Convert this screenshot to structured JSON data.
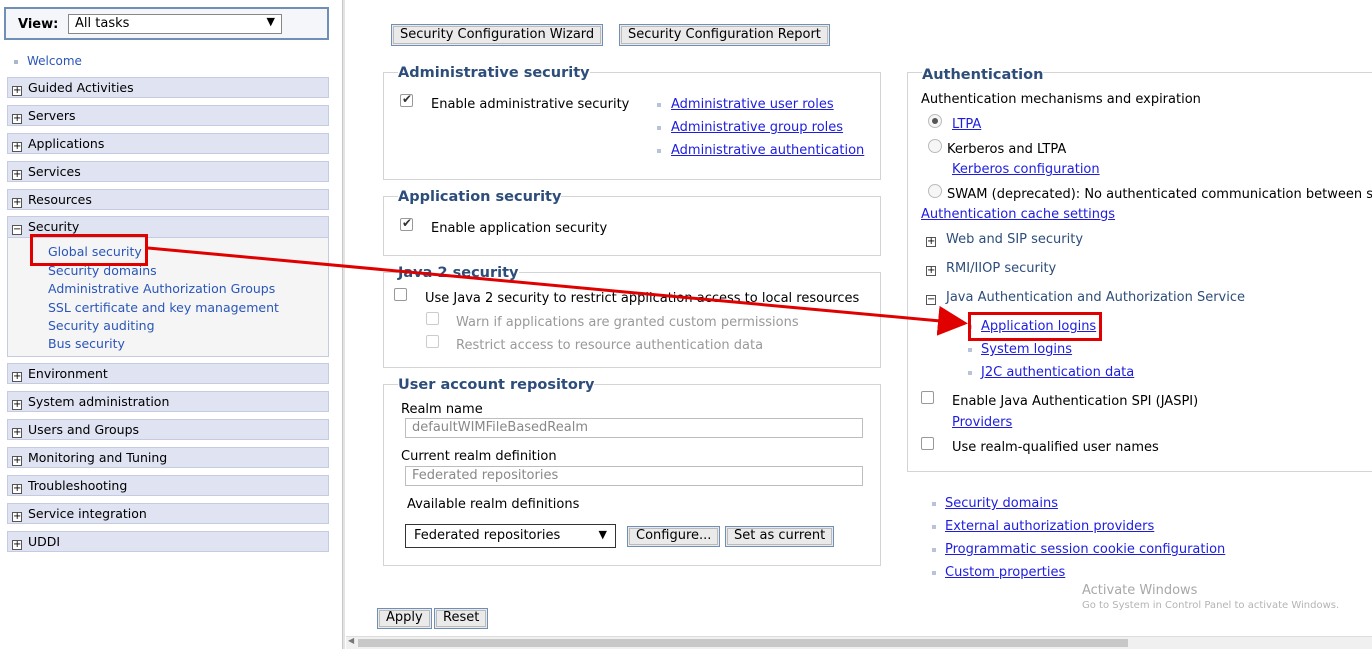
{
  "nav": {
    "view_label": "View:",
    "view_value": "All tasks",
    "welcome": "Welcome",
    "items_top": [
      "Guided Activities",
      "Servers",
      "Applications",
      "Services",
      "Resources"
    ],
    "security": {
      "label": "Security",
      "children": [
        "Global security",
        "Security domains",
        "Administrative Authorization Groups",
        "SSL certificate and key management",
        "Security auditing",
        "Bus security"
      ]
    },
    "items_bottom": [
      "Environment",
      "System administration",
      "Users and Groups",
      "Monitoring and Tuning",
      "Troubleshooting",
      "Service integration",
      "UDDI"
    ]
  },
  "main": {
    "wizard_button": "Security Configuration Wizard",
    "report_button": "Security Configuration Report",
    "admin_security": {
      "title": "Administrative security",
      "enable_label": "Enable administrative security",
      "links": [
        "Administrative user roles",
        "Administrative group roles",
        "Administrative authentication"
      ]
    },
    "app_security": {
      "title": "Application security",
      "enable_label": "Enable application security"
    },
    "java2": {
      "title": "Java 2 security",
      "use_label": "Use Java 2 security to restrict application access to local resources",
      "warn_label": "Warn if applications are granted custom permissions",
      "restrict_label": "Restrict access to resource authentication data"
    },
    "user_repo": {
      "title": "User account repository",
      "realm_name_label": "Realm name",
      "realm_name_value": "defaultWIMFileBasedRealm",
      "current_realm_label": "Current realm definition",
      "current_realm_value": "Federated repositories",
      "available_label": "Available realm definitions",
      "available_value": "Federated repositories",
      "configure_button": "Configure...",
      "set_current_button": "Set as current"
    },
    "authentication": {
      "title": "Authentication",
      "mechanisms_label": "Authentication mechanisms and expiration",
      "ltpa": "LTPA",
      "kerberos_ltpa": "Kerberos and LTPA",
      "kerberos_config": "Kerberos configuration",
      "swam": "SWAM (deprecated): No authenticated communication between se",
      "cache_settings": "Authentication cache settings",
      "web_sip": "Web and SIP security",
      "rmi_iiop": "RMI/IIOP security",
      "jaas": "Java Authentication and Authorization Service",
      "app_logins": "Application logins",
      "system_logins": "System logins",
      "j2c_data": "J2C authentication data",
      "jaspi_label": "Enable Java Authentication SPI (JASPI)",
      "providers": "Providers",
      "realm_qualified": "Use realm-qualified user names"
    },
    "bottom_links": [
      "Security domains",
      "External authorization providers",
      "Programmatic session cookie configuration",
      "Custom properties"
    ],
    "apply_button": "Apply",
    "reset_button": "Reset"
  },
  "watermark": {
    "title": "Activate Windows",
    "subtitle": "Go to System in Control Panel to activate Windows."
  },
  "colors": {
    "highlight": "#e00000",
    "link": "#1d1de0",
    "nav_bg": "#dfe3f2",
    "section_title": "#2d4d7a"
  }
}
